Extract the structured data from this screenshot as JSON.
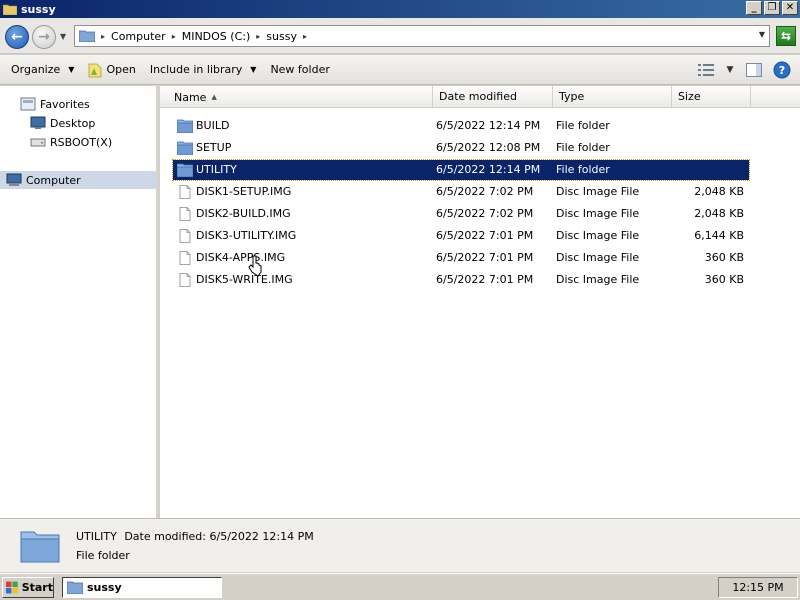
{
  "window": {
    "title": "sussy"
  },
  "address": {
    "crumbs": [
      "Computer",
      "MINDOS (C:)",
      "sussy"
    ]
  },
  "toolbar": {
    "organize": "Organize",
    "open": "Open",
    "include_in_library": "Include in library",
    "new_folder": "New folder"
  },
  "nav": {
    "favorites": "Favorites",
    "desktop": "Desktop",
    "rsboot": "RSBOOT(X)",
    "computer": "Computer"
  },
  "columns": {
    "name": "Name",
    "date": "Date modified",
    "type": "Type",
    "size": "Size"
  },
  "files": [
    {
      "name": "BUILD",
      "date": "6/5/2022 12:14 PM",
      "type": "File folder",
      "size": "",
      "icon": "folder-icon"
    },
    {
      "name": "SETUP",
      "date": "6/5/2022 12:08 PM",
      "type": "File folder",
      "size": "",
      "icon": "folder-icon"
    },
    {
      "name": "UTILITY",
      "date": "6/5/2022 12:14 PM",
      "type": "File folder",
      "size": "",
      "icon": "folder-icon",
      "selected": true
    },
    {
      "name": "DISK1-SETUP.IMG",
      "date": "6/5/2022 7:02 PM",
      "type": "Disc Image File",
      "size": "2,048 KB",
      "icon": "file-icon"
    },
    {
      "name": "DISK2-BUILD.IMG",
      "date": "6/5/2022 7:02 PM",
      "type": "Disc Image File",
      "size": "2,048 KB",
      "icon": "file-icon"
    },
    {
      "name": "DISK3-UTILITY.IMG",
      "date": "6/5/2022 7:01 PM",
      "type": "Disc Image File",
      "size": "6,144 KB",
      "icon": "file-icon"
    },
    {
      "name": "DISK4-APPS.IMG",
      "date": "6/5/2022 7:01 PM",
      "type": "Disc Image File",
      "size": "360 KB",
      "icon": "file-icon"
    },
    {
      "name": "DISK5-WRITE.IMG",
      "date": "6/5/2022 7:01 PM",
      "type": "Disc Image File",
      "size": "360 KB",
      "icon": "file-icon"
    }
  ],
  "details": {
    "name": "UTILITY",
    "date_label": "Date modified:",
    "date_value": "6/5/2022 12:14 PM",
    "type": "File folder"
  },
  "taskbar": {
    "start": "Start",
    "task": "sussy",
    "clock": "12:15 PM"
  },
  "colors": {
    "selection": "#0a246a",
    "titlebar_start": "#0a246a",
    "titlebar_end": "#3a6ea5"
  }
}
